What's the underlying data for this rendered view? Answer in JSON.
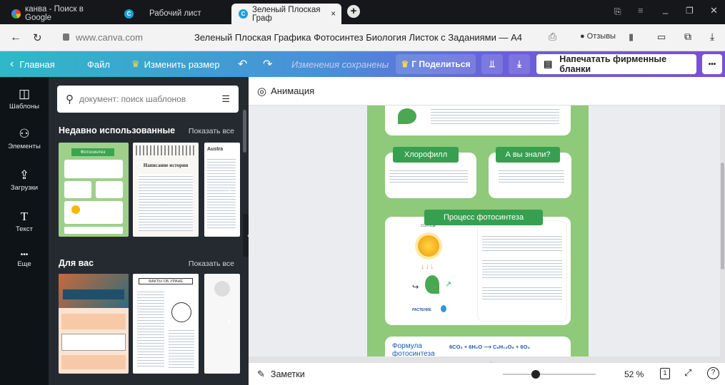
{
  "browser": {
    "tabs": [
      {
        "label": "канва - Поиск в Google",
        "icon": "google-icon"
      },
      {
        "label": "Рабочий лист",
        "icon": "canva-icon"
      },
      {
        "label": "Зеленый Плоская Граф",
        "icon": "canva-icon",
        "active": true
      }
    ],
    "close_label": "×",
    "url": "www.canva.com",
    "page_title": "Зеленый Плоская Графика Фотосинтез Биология Листок с Заданиями — A4",
    "reviews_label": "Отзывы"
  },
  "canva": {
    "home": "Главная",
    "file": "Файл",
    "resize": "Изменить размер",
    "saved": "Изменения сохранены",
    "share": "Г Поделиться",
    "print": "Напечатать фирменные бланки",
    "more": "•••",
    "accent": "#7b4fd6"
  },
  "rail": [
    {
      "label": "Шаблоны",
      "glyph": "◫"
    },
    {
      "label": "Элементы",
      "glyph": "⚇"
    },
    {
      "label": "Загрузки",
      "glyph": "⇪"
    },
    {
      "label": "Текст",
      "glyph": "T"
    },
    {
      "label": "Еще",
      "glyph": "•••"
    }
  ],
  "panel": {
    "search_placeholder": "документ: поиск шаблонов",
    "recent_title": "Недавно использованные",
    "for_you_title": "Для вас",
    "show_all": "Показать все",
    "recent_thumbs": [
      "Фотосинтез",
      "Написание истории",
      "Austra"
    ],
    "foryou_thumbs": [
      "",
      "ФАКТЫ ОБ УРАНЕ",
      ""
    ]
  },
  "toolbar": {
    "animation": "Анимация"
  },
  "document": {
    "chlorophyll": "Хлорофилл",
    "did_you_know": "А вы знали?",
    "process": "Процесс фотосинтеза",
    "formula_label": "Формула фотосинтеза",
    "formula": "6CO₂ + 6H₂O ⟶ C₆H₁₂O₆ + 6O₂",
    "sun": "СОЛНЦЕ",
    "plant": "РАСТЕНИЕ"
  },
  "bottom": {
    "notes": "Заметки",
    "zoom": "52 %",
    "zoom_fraction": 0.35,
    "page_count": "1"
  }
}
